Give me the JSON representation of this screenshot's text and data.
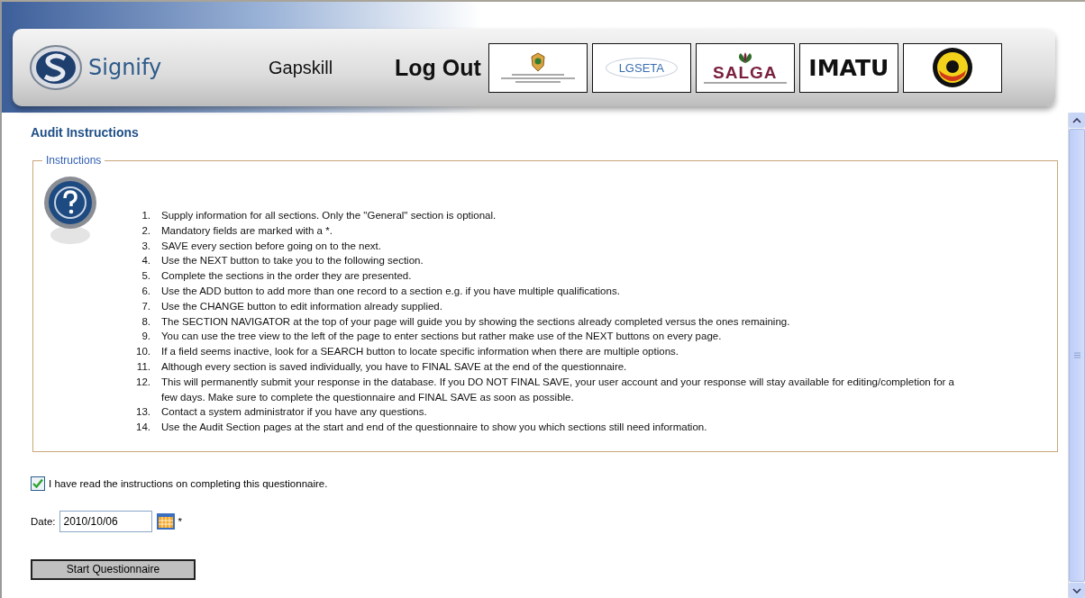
{
  "header": {
    "brand": "Signify",
    "app_name": "Gapskill",
    "logout": "Log Out",
    "logos": [
      {
        "kind": "crest"
      },
      {
        "kind": "lgseta",
        "lines": [
          "LGSETA"
        ]
      },
      {
        "kind": "salga",
        "lines": [
          "SALGA"
        ]
      },
      {
        "kind": "imatu",
        "lines": [
          "IMATU"
        ]
      },
      {
        "kind": "seal"
      }
    ]
  },
  "page_title": "Audit Instructions",
  "instructions": {
    "legend": "Instructions",
    "items": [
      {
        "number": "1.",
        "text": "Supply information for all sections. Only the \"General\" section is optional."
      },
      {
        "number": "2.",
        "text": "Mandatory fields are marked with a *."
      },
      {
        "number": "3.",
        "text": "SAVE every section before going on to the next."
      },
      {
        "number": "4.",
        "text": "Use the NEXT button to take you to the following section."
      },
      {
        "number": "5.",
        "text": "Complete the sections in the order they are presented."
      },
      {
        "number": "6.",
        "text": "Use the ADD button to add more than one record to a section e.g. if you have multiple qualifications."
      },
      {
        "number": "7.",
        "text": "Use the CHANGE button to edit information already supplied."
      },
      {
        "number": "8.",
        "text": "The SECTION NAVIGATOR at the top of your page will guide you by showing the sections already completed versus the ones remaining."
      },
      {
        "number": "9.",
        "text": "You can use the tree view to the left of the page to enter sections but rather make use of the NEXT buttons on every page."
      },
      {
        "number": "10.",
        "text": "If a field seems inactive, look for a SEARCH button to locate specific information when there are multiple options."
      },
      {
        "number": "11.",
        "text": "Although every section is saved individually, you have to FINAL SAVE at the end of the questionnaire."
      },
      {
        "number": "12.",
        "text": "This will permanently submit your response in the database. If you DO NOT FINAL SAVE, your user account and your response will stay available for editing/completion for a few days. Make sure to complete the questionnaire and FINAL SAVE as soon as possible."
      },
      {
        "number": "13.",
        "text": "Contact a system administrator if you have any questions."
      },
      {
        "number": "14.",
        "text": "Use the Audit Section pages at the start and end of the questionnaire to show you which sections still need information."
      }
    ]
  },
  "agreement": {
    "label": "I have read the instructions on completing this questionnaire.",
    "checked": true
  },
  "date": {
    "label": "Date:",
    "value": "2010/10/06",
    "required_mark": "*"
  },
  "start_button": "Start Questionnaire"
}
